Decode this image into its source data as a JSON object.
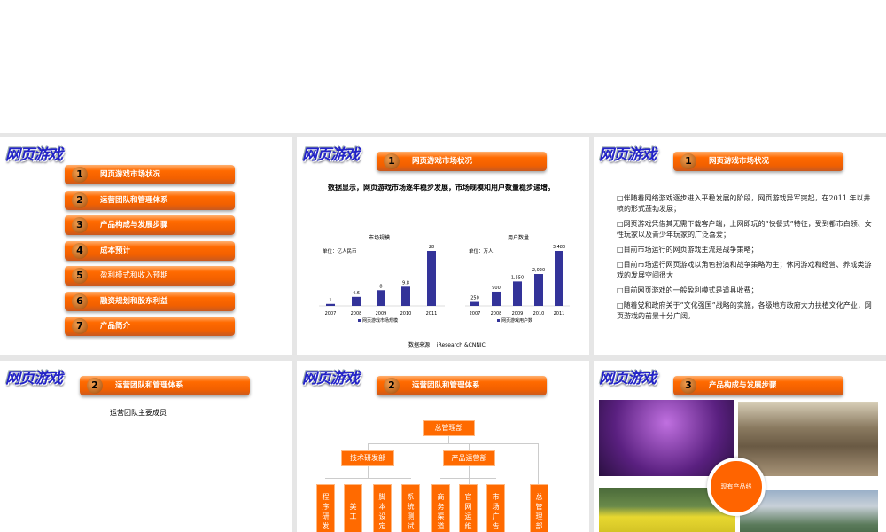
{
  "logo_text": "网页游戏",
  "slides": [
    {
      "menu": [
        {
          "n": "1",
          "label": "网页游戏市场状况"
        },
        {
          "n": "2",
          "label": "运营团队和管理体系"
        },
        {
          "n": "3",
          "label": "产品构成与发展步骤"
        },
        {
          "n": "4",
          "label": "成本预计"
        },
        {
          "n": "5",
          "label": "盈利模式和收入预期"
        },
        {
          "n": "6",
          "label": "融资规划和股东利益"
        },
        {
          "n": "7",
          "label": "产品简介"
        }
      ]
    },
    {
      "banner": {
        "n": "1",
        "label": "网页游戏市场状况"
      },
      "subtitle": "数据显示，网页游戏市场逐年稳步发展，市场规模和用户数量稳步递增。",
      "source": "数据来源：  iResearch &CNNIC"
    },
    {
      "banner": {
        "n": "1",
        "label": "网页游戏市场状况"
      },
      "bullets": [
        "伴随着网络游戏逐步进入平稳发展的阶段，网页游戏异军突起，在2011 年以井喷的形式蓬勃发展；",
        "网页游戏凭借其无需下载客户端，上网即玩的“快餐式”特征，受到都市白领、女性玩家以及青少年玩家的广泛喜爱；",
        "目前市场运行的网页游戏主流是战争策略；",
        "目前市场运行网页游戏以角色扮演和战争策略为主；休闲游戏和经营、养成类游戏的发展空间很大",
        "目前网页游戏的一般盈利模式是道具收费；",
        "随着党和政府关于“文化强国”战略的实施，各级地方政府大力扶植文化产业，网页游戏的前景十分广阔。"
      ]
    },
    {
      "banner": {
        "n": "2",
        "label": "运营团队和管理体系"
      },
      "text": "运营团队主要成员"
    },
    {
      "banner": {
        "n": "2",
        "label": "运营团队和管理体系"
      },
      "org": {
        "top": "总管理部",
        "mid": [
          "技术研发部",
          "产品运营部"
        ],
        "leaves": [
          "程序研发",
          "美工",
          "脚本设定",
          "系统测试",
          "商务渠道",
          "官网运维",
          "市场广告",
          "总管理部"
        ]
      }
    },
    {
      "banner": {
        "n": "3",
        "label": "产品构成与发展步骤"
      },
      "circle": "现有产品线"
    }
  ],
  "chart_data": [
    {
      "type": "bar",
      "title": "市场规模",
      "unit": "单位：亿人民币",
      "categories": [
        "2007",
        "2008",
        "2009",
        "2010",
        "2011"
      ],
      "values": [
        1,
        4.6,
        8,
        9.8,
        28
      ],
      "labels": [
        "1",
        "4.6",
        "8",
        "9.8",
        "28"
      ],
      "legend": "网页游戏市场规模",
      "color": "#333399"
    },
    {
      "type": "bar",
      "title": "用户数量",
      "unit": "单位：万人",
      "categories": [
        "2007",
        "2008",
        "2009",
        "2010",
        "2011"
      ],
      "values": [
        250,
        900,
        1550,
        2020,
        3480
      ],
      "labels": [
        "250",
        "900",
        "1,550",
        "2,020",
        "3,480"
      ],
      "legend": "网页游戏用户数",
      "color": "#333399"
    }
  ]
}
